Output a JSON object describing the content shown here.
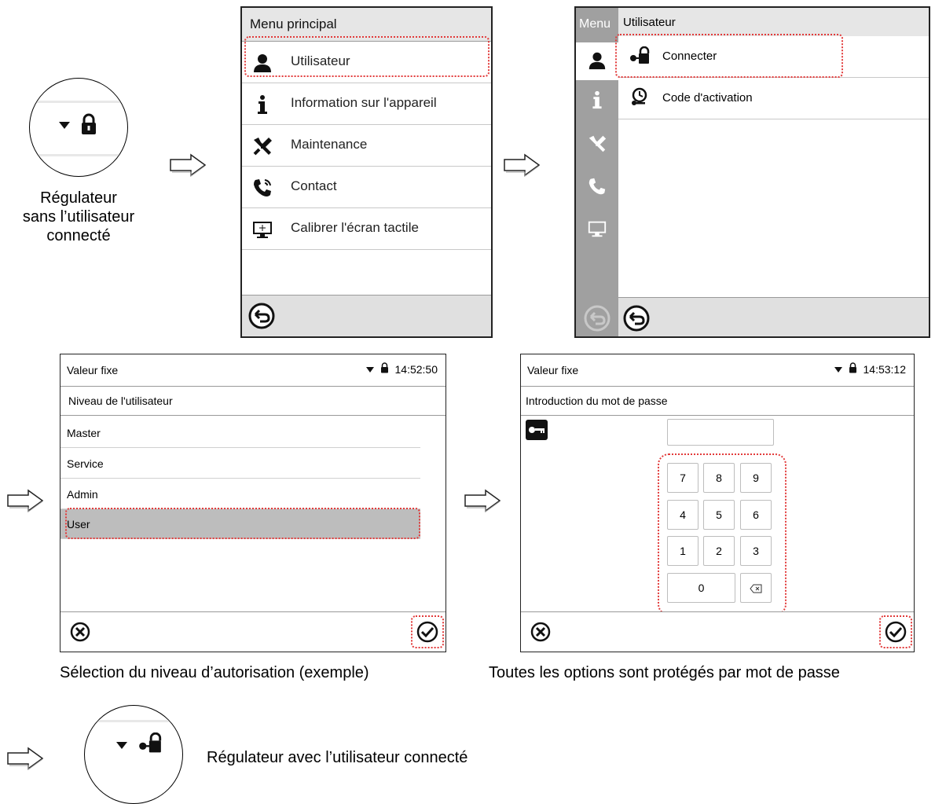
{
  "regulator_off": {
    "caption_lines": [
      "Régulateur",
      "sans l’utilisateur",
      "connecté"
    ]
  },
  "main_menu": {
    "title": "Menu principal",
    "items": [
      {
        "label": "Utilisateur",
        "icon": "user-icon"
      },
      {
        "label": "Information sur l'appareil",
        "icon": "info-icon"
      },
      {
        "label": "Maintenance",
        "icon": "tools-icon"
      },
      {
        "label": "Contact",
        "icon": "phone-icon"
      },
      {
        "label": "Calibrer l'écran tactile",
        "icon": "monitor-icon"
      }
    ]
  },
  "user_menu": {
    "side_title": "Menu",
    "title": "Utilisateur",
    "items": [
      {
        "label": "Connecter",
        "icon": "login-lock-icon"
      },
      {
        "label": "Code d'activation",
        "icon": "activation-code-icon"
      }
    ]
  },
  "level_screen": {
    "title": "Valeur fixe",
    "time": "14:52:50",
    "subheader": "Niveau de l'utilisateur",
    "levels": [
      "Master",
      "Service",
      "Admin",
      "User"
    ],
    "selected": "User",
    "caption": "Sélection du niveau d’autorisation (exemple)"
  },
  "password_screen": {
    "title": "Valeur fixe",
    "time": "14:53:12",
    "subheader": "Introduction du mot de passe",
    "keys": [
      "7",
      "8",
      "9",
      "4",
      "5",
      "6",
      "1",
      "2",
      "3",
      "0"
    ],
    "caption": "Toutes les options sont protégés par mot de passe"
  },
  "regulator_on": {
    "caption": "Régulateur avec l’utilisateur connecté"
  },
  "colors": {
    "highlight": "#e23b3b",
    "header_gray": "#e6e6e6",
    "sidebar_gray": "#a0a0a0",
    "selected_row": "#bdbdbd"
  }
}
